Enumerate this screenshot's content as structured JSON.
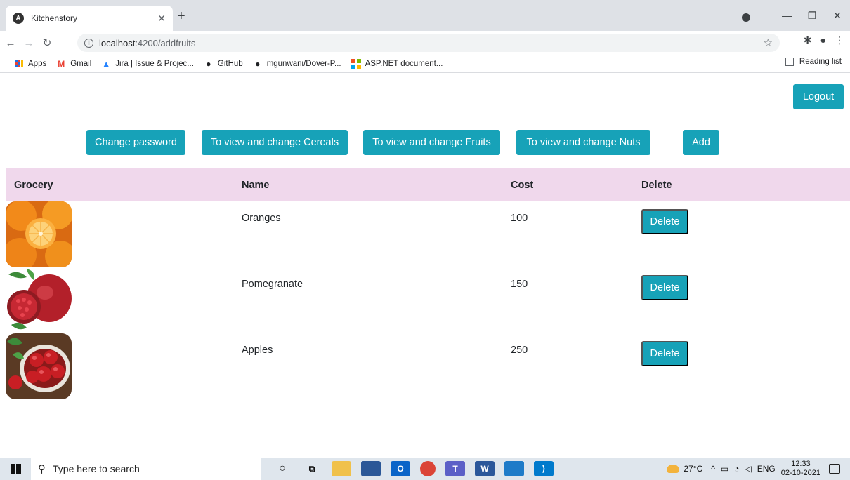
{
  "browser": {
    "tab_title": "Kitchenstory",
    "tab_favicon": "A",
    "url_host": "localhost",
    "url_path": ":4200/addfruits",
    "bookmarks": [
      "Apps",
      "Gmail",
      "Jira | Issue & Projec...",
      "GitHub",
      "mgunwani/Dover-P...",
      "ASP.NET document..."
    ],
    "reading_list": "Reading list"
  },
  "header": {
    "logout_label": "Logout"
  },
  "actions": {
    "change_password": "Change password",
    "cereals": "To view and change Cereals",
    "fruits": "To view and change Fruits",
    "nuts": "To view and change Nuts",
    "add": "Add"
  },
  "table": {
    "columns": [
      "Grocery",
      "Name",
      "Cost",
      "Delete"
    ],
    "rows": [
      {
        "name": "Oranges",
        "cost": "100",
        "delete_label": "Delete"
      },
      {
        "name": "Pomegranate",
        "cost": "150",
        "delete_label": "Delete"
      },
      {
        "name": "Apples",
        "cost": "250",
        "delete_label": "Delete"
      }
    ]
  },
  "taskbar": {
    "search_placeholder": "Type here to search",
    "temperature": "27°C",
    "language": "ENG",
    "time": "12:33",
    "date": "02-10-2021"
  },
  "colors": {
    "button": "#17a2b8",
    "table_header": "#f0d8ec"
  }
}
